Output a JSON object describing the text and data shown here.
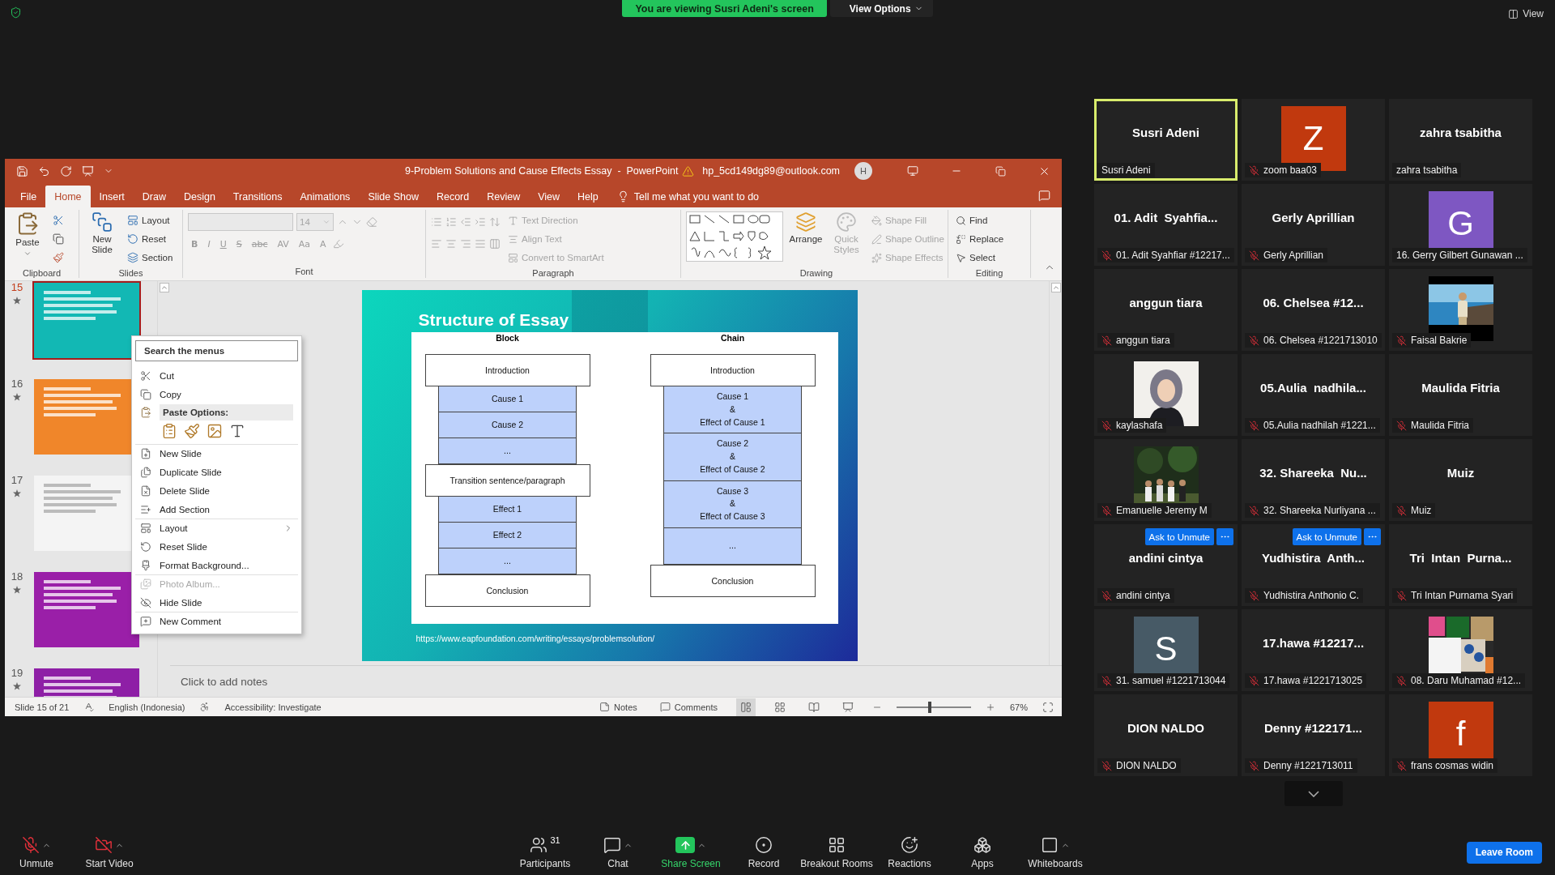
{
  "top_bar": {
    "banner": "You are viewing Susri Adeni's screen",
    "view_options": "View Options",
    "view": "View"
  },
  "powerpoint": {
    "title": "9-Problem Solutions and Cause Effects Essay  -  PowerPoint",
    "account": "hp_5cd149dg89@outlook.com",
    "avatar": "H",
    "tabs": [
      {
        "label": "File",
        "selected": false
      },
      {
        "label": "Home",
        "selected": true
      },
      {
        "label": "Insert",
        "selected": false
      },
      {
        "label": "Draw",
        "selected": false
      },
      {
        "label": "Design",
        "selected": false
      },
      {
        "label": "Transitions",
        "selected": false
      },
      {
        "label": "Animations",
        "selected": false
      },
      {
        "label": "Slide Show",
        "selected": false
      },
      {
        "label": "Record",
        "selected": false
      },
      {
        "label": "Review",
        "selected": false
      },
      {
        "label": "View",
        "selected": false
      },
      {
        "label": "Help",
        "selected": false
      }
    ],
    "tell_me": "Tell me what you want to do",
    "ribbon": [
      {
        "kind": "clipboard",
        "label": "Clipboard",
        "items": [
          {
            "label": "Paste",
            "disabled": false
          }
        ]
      },
      {
        "kind": "slides",
        "label": "Slides",
        "items": [
          {
            "label": "New Slide",
            "disabled": false
          },
          {
            "label": "Layout",
            "disabled": false
          },
          {
            "label": "Reset",
            "disabled": false
          },
          {
            "label": "Section",
            "disabled": false
          }
        ]
      },
      {
        "kind": "font",
        "label": "Font",
        "size": "14",
        "items": [
          {
            "label": "B",
            "disabled": true
          },
          {
            "label": "I",
            "disabled": true
          },
          {
            "label": "U",
            "disabled": true
          },
          {
            "label": "S",
            "disabled": true
          },
          {
            "label": "abc",
            "disabled": true
          },
          {
            "label": "AV",
            "disabled": true
          },
          {
            "label": "Aa",
            "disabled": true
          },
          {
            "label": "A",
            "disabled": true
          }
        ]
      },
      {
        "kind": "paragraph",
        "label": "Paragraph",
        "items": [
          {
            "label": "Text Direction",
            "disabled": true
          },
          {
            "label": "Align Text",
            "disabled": true
          },
          {
            "label": "Convert to SmartArt",
            "disabled": true
          }
        ]
      },
      {
        "kind": "drawing",
        "label": "Drawing",
        "items": [
          {
            "label": "Arrange",
            "disabled": false
          },
          {
            "label": "Quick Styles",
            "disabled": true
          },
          {
            "label": "Shape Fill",
            "disabled": true
          },
          {
            "label": "Shape Outline",
            "disabled": true
          },
          {
            "label": "Shape Effects",
            "disabled": true
          }
        ]
      },
      {
        "kind": "editing",
        "label": "Editing",
        "items": [
          {
            "label": "Find",
            "disabled": false
          },
          {
            "label": "Replace",
            "disabled": false
          },
          {
            "label": "Select",
            "disabled": false
          }
        ]
      }
    ],
    "thumbnails": [
      {
        "number": "15",
        "selected": true,
        "color": "#12b8b4"
      },
      {
        "number": "16",
        "selected": false,
        "color": "#f0862a"
      },
      {
        "number": "17",
        "selected": false,
        "color": "#f4f4f4"
      },
      {
        "number": "18",
        "selected": false,
        "color": "#9a1fa8"
      },
      {
        "number": "19",
        "selected": false,
        "color": "#8e1fa6"
      }
    ],
    "context_menu": {
      "placeholder": "Search the menus",
      "items": [
        {
          "kind": "item",
          "label": "Cut",
          "disabled": false,
          "divider_above": false,
          "submenu": false
        },
        {
          "kind": "item",
          "label": "Copy",
          "disabled": false,
          "divider_above": false,
          "submenu": false
        },
        {
          "kind": "header",
          "label": "Paste Options:"
        },
        {
          "kind": "paste_icons"
        },
        {
          "kind": "item",
          "label": "New Slide",
          "disabled": false,
          "divider_above": true,
          "submenu": false
        },
        {
          "kind": "item",
          "label": "Duplicate Slide",
          "disabled": false,
          "divider_above": false,
          "submenu": false
        },
        {
          "kind": "item",
          "label": "Delete Slide",
          "disabled": false,
          "divider_above": false,
          "submenu": false
        },
        {
          "kind": "item",
          "label": "Add Section",
          "disabled": false,
          "divider_above": false,
          "submenu": false
        },
        {
          "kind": "item",
          "label": "Layout",
          "disabled": false,
          "divider_above": true,
          "submenu": true
        },
        {
          "kind": "item",
          "label": "Reset Slide",
          "disabled": false,
          "divider_above": false,
          "submenu": false
        },
        {
          "kind": "item",
          "label": "Format Background...",
          "disabled": false,
          "divider_above": false,
          "submenu": false
        },
        {
          "kind": "item",
          "label": "Photo Album...",
          "disabled": true,
          "divider_above": true,
          "submenu": false
        },
        {
          "kind": "item",
          "label": "Hide Slide",
          "disabled": false,
          "divider_above": false,
          "submenu": false
        },
        {
          "kind": "item",
          "label": "New Comment",
          "disabled": false,
          "divider_above": true,
          "submenu": false
        }
      ]
    },
    "slide": {
      "title": "Structure of Essay",
      "url": "https://www.eapfoundation.com/writing/essays/problemsolution/",
      "columns": [
        {
          "heading": "Block",
          "boxes": [
            {
              "kind": "outer",
              "text": "Introduction"
            },
            {
              "kind": "inner",
              "text": "Cause 1"
            },
            {
              "kind": "inner",
              "text": "Cause 2"
            },
            {
              "kind": "inner",
              "text": "..."
            },
            {
              "kind": "outer",
              "text": "Transition sentence/paragraph"
            },
            {
              "kind": "inner",
              "text": "Effect 1"
            },
            {
              "kind": "inner",
              "text": "Effect 2"
            },
            {
              "kind": "inner",
              "text": "..."
            },
            {
              "kind": "outer",
              "text": "Conclusion"
            }
          ]
        },
        {
          "heading": "Chain",
          "boxes": [
            {
              "kind": "outer",
              "text": "Introduction"
            },
            {
              "kind": "inner",
              "text": "Cause 1\n&\nEffect of Cause 1"
            },
            {
              "kind": "inner",
              "text": "Cause 2\n&\nEffect of Cause 2"
            },
            {
              "kind": "inner",
              "text": "Cause 3\n&\nEffect of Cause 3"
            },
            {
              "kind": "inner",
              "text": "..."
            },
            {
              "kind": "outer",
              "text": "Conclusion"
            }
          ]
        }
      ]
    },
    "notes_placeholder": "Click to add notes",
    "status_bar": {
      "slide": "Slide 15 of 21",
      "language": "English (Indonesia)",
      "accessibility": "Accessibility: Investigate",
      "notes": "Notes",
      "comments": "Comments",
      "zoom": "67%",
      "level": 0.45
    }
  },
  "tiles": [
    {
      "kind": "name",
      "title": "Susri Adeni",
      "label": "Susri Adeni",
      "muted": false,
      "selected": true
    },
    {
      "kind": "avatar",
      "letter": "Z",
      "color": "#c1390e",
      "label": "zoom baa03",
      "muted": true,
      "selected": false
    },
    {
      "kind": "name",
      "title": "zahra tsabitha",
      "label": "zahra tsabitha",
      "muted": false,
      "selected": false
    },
    {
      "kind": "name",
      "title": "01. Adit  Syahfia...",
      "label": "01. Adit Syahfiar #12217...",
      "muted": true,
      "selected": false
    },
    {
      "kind": "name",
      "title": "Gerly Aprillian",
      "label": "Gerly Aprillian",
      "muted": true,
      "selected": false
    },
    {
      "kind": "avatar",
      "letter": "G",
      "color": "#7e57c2",
      "label": "16. Gerry Gilbert Gunawan ...",
      "muted": false,
      "selected": false
    },
    {
      "kind": "name",
      "title": "anggun tiara",
      "label": "anggun tiara",
      "muted": true,
      "selected": false
    },
    {
      "kind": "name",
      "title": "06. Chelsea #12...",
      "label": "06. Chelsea #1221713010",
      "muted": true,
      "selected": false
    },
    {
      "kind": "picture",
      "label": "Faisal Bakrie",
      "muted": true,
      "selected": false
    },
    {
      "kind": "picture",
      "label": "kaylashafa",
      "muted": true,
      "selected": false
    },
    {
      "kind": "name",
      "title": "05.Aulia  nadhila...",
      "label": "05.Aulia nadhilah #1221...",
      "muted": true,
      "selected": false
    },
    {
      "kind": "name",
      "title": "Maulida Fitria",
      "label": "Maulida Fitria",
      "muted": true,
      "selected": false
    },
    {
      "kind": "picture",
      "label": "Emanuelle Jeremy M",
      "muted": true,
      "selected": false
    },
    {
      "kind": "name",
      "title": "32. Shareeka  Nu...",
      "label": "32. Shareeka Nurliyana ...",
      "muted": true,
      "selected": false
    },
    {
      "kind": "name",
      "title": "Muiz",
      "label": "Muiz",
      "muted": true,
      "selected": false
    },
    {
      "kind": "name",
      "title": "andini cintya",
      "label": "andini cintya",
      "muted": true,
      "selected": false,
      "ask_button": "Ask to Unmute"
    },
    {
      "kind": "name",
      "title": "Yudhistira  Anth...",
      "label": "Yudhistira Anthonio C.",
      "muted": true,
      "selected": false,
      "ask_button": "Ask to Unmute"
    },
    {
      "kind": "name",
      "title": "Tri  Intan  Purna...",
      "label": "Tri Intan Purnama Syari",
      "muted": true,
      "selected": false
    },
    {
      "kind": "avatar",
      "letter": "S",
      "color": "#475a66",
      "label": "31. samuel #1221713044",
      "muted": true,
      "selected": false
    },
    {
      "kind": "name",
      "title": "17.hawa #12217...",
      "label": "17.hawa #1221713025",
      "muted": true,
      "selected": false
    },
    {
      "kind": "picture",
      "label": "08. Daru Muhamad #12...",
      "muted": true,
      "selected": false
    },
    {
      "kind": "name",
      "title": "DION NALDO",
      "label": "DION NALDO",
      "muted": true,
      "selected": false
    },
    {
      "kind": "name",
      "title": "Denny #122171...",
      "label": "Denny #1221713011",
      "muted": true,
      "selected": false
    },
    {
      "kind": "avatar",
      "letter": "f",
      "color": "#c1390e",
      "label": "frans cosmas widin",
      "muted": true,
      "selected": false
    }
  ],
  "toolbar": [
    {
      "kind": "mute",
      "label": "Unmute",
      "caret": true
    },
    {
      "kind": "video",
      "label": "Start Video",
      "caret": true
    },
    {
      "kind": "participants",
      "label": "Participants",
      "count": "31",
      "caret": false
    },
    {
      "kind": "chat",
      "label": "Chat",
      "caret": true
    },
    {
      "kind": "share",
      "label": "Share Screen",
      "caret": true
    },
    {
      "kind": "record",
      "label": "Record",
      "caret": false
    },
    {
      "kind": "breakout",
      "label": "Breakout Rooms",
      "caret": false
    },
    {
      "kind": "reactions",
      "label": "Reactions",
      "caret": false
    },
    {
      "kind": "apps",
      "label": "Apps",
      "caret": false
    },
    {
      "kind": "whiteboards",
      "label": "Whiteboards",
      "caret": true
    }
  ],
  "leave_button": "Leave Room"
}
